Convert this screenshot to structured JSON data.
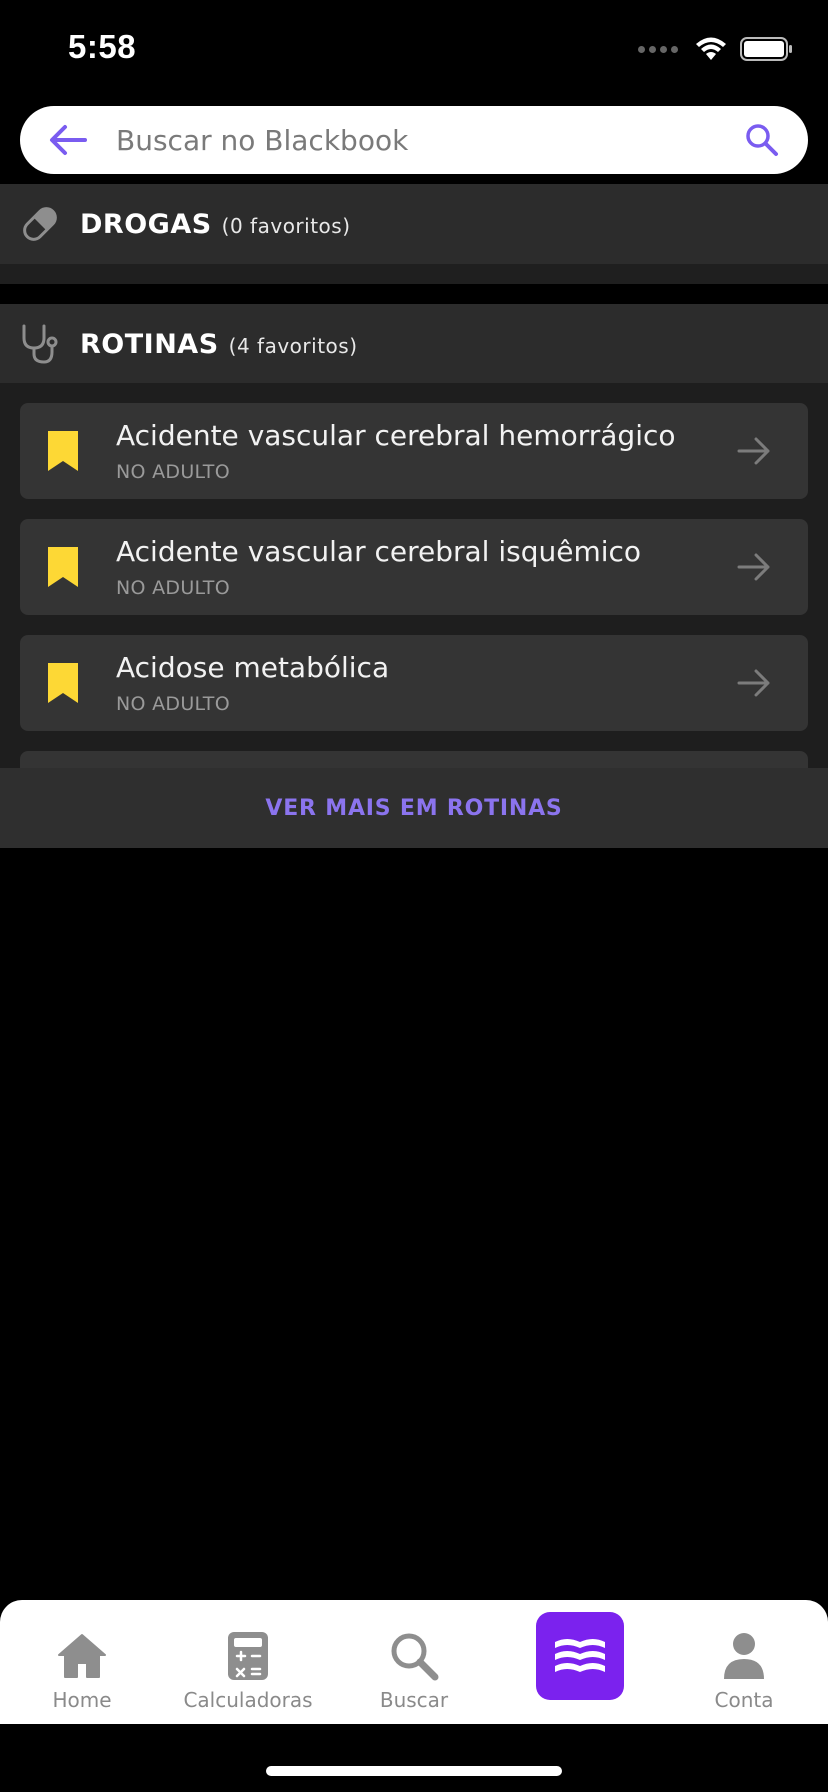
{
  "status": {
    "time": "5:58"
  },
  "search": {
    "placeholder": "Buscar no Blackbook"
  },
  "drogas": {
    "title": "DROGAS",
    "count": "(0 favoritos)"
  },
  "rotinas": {
    "title": "ROTINAS",
    "count": "(4 favoritos)",
    "items": [
      {
        "title": "Acidente vascular cerebral hemorrágico",
        "subtitle": "NO ADULTO"
      },
      {
        "title": "Acidente vascular cerebral isquêmico",
        "subtitle": "NO ADULTO"
      },
      {
        "title": "Acidose metabólica",
        "subtitle": "NO ADULTO"
      }
    ],
    "see_more": "VER MAIS EM ROTINAS"
  },
  "tabs": [
    {
      "label": "Home",
      "icon": "home-icon"
    },
    {
      "label": "Calculadoras",
      "icon": "calculator-icon"
    },
    {
      "label": "Buscar",
      "icon": "search-icon"
    },
    {
      "label": "",
      "icon": "book-icon"
    },
    {
      "label": "Conta",
      "icon": "person-icon"
    }
  ],
  "colors": {
    "accent": "#7b22ee",
    "link": "#8b74ee",
    "bookmark": "#fdd835"
  }
}
